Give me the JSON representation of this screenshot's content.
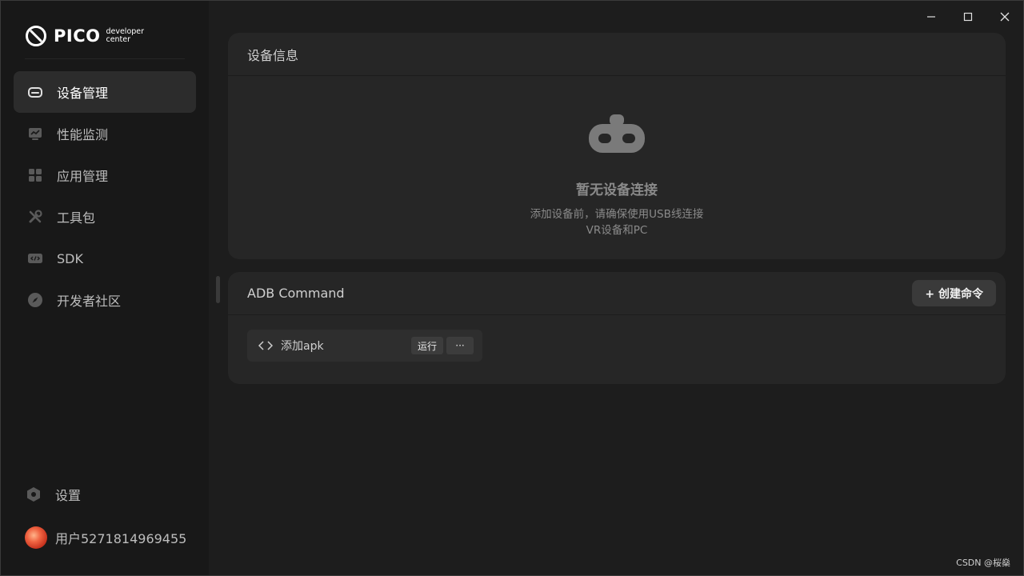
{
  "logo": {
    "name": "PICO",
    "sub_line1": "developer",
    "sub_line2": "center"
  },
  "nav": {
    "items": [
      {
        "label": "设备管理",
        "icon": "headset-icon",
        "active": true
      },
      {
        "label": "性能监测",
        "icon": "monitor-chart-icon",
        "active": false
      },
      {
        "label": "应用管理",
        "icon": "apps-grid-icon",
        "active": false
      },
      {
        "label": "工具包",
        "icon": "tools-icon",
        "active": false
      },
      {
        "label": "SDK",
        "icon": "code-icon",
        "active": false
      },
      {
        "label": "开发者社区",
        "icon": "compass-icon",
        "active": false
      }
    ]
  },
  "settings": {
    "label": "设置",
    "icon": "settings-hex-icon"
  },
  "user": {
    "name": "用户5271814969455"
  },
  "device_panel": {
    "title": "设备信息",
    "empty_title": "暂无设备连接",
    "empty_desc": "添加设备前，请确保使用USB线连接VR设备和PC"
  },
  "adb_panel": {
    "title": "ADB Command",
    "create_label": "+ 创建命令",
    "commands": [
      {
        "label": "添加apk",
        "run_label": "运行",
        "more_label": "···"
      }
    ]
  },
  "watermark": "CSDN @桜燊",
  "colors": {
    "background": "#1d1d1d",
    "sidebar": "#181818",
    "panel": "#262626",
    "accent_text": "#ffffff"
  }
}
